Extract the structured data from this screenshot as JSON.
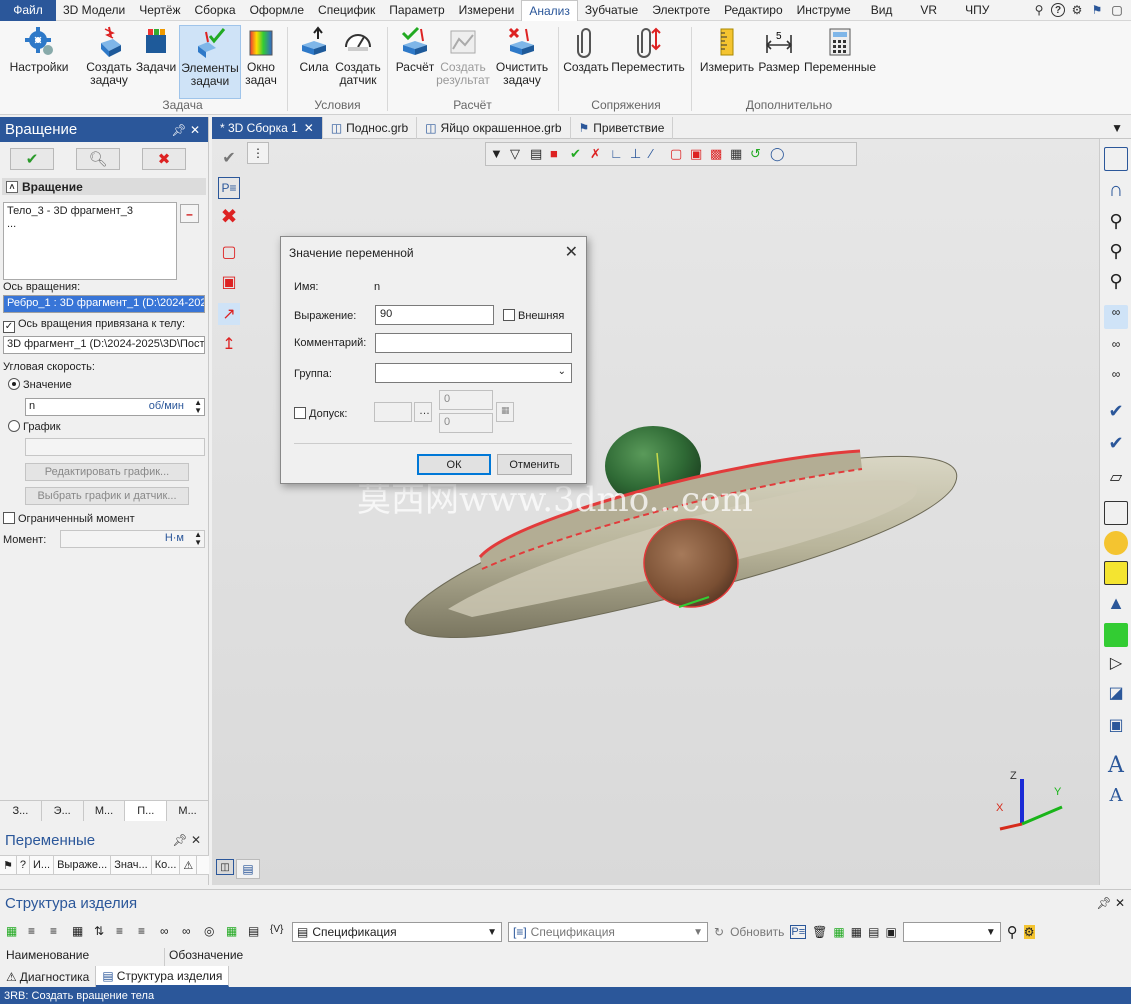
{
  "menu": {
    "file": "Файл",
    "items": [
      "3D Модели",
      "Чертёж",
      "Сборка",
      "Оформле",
      "Специфик",
      "Параметр",
      "Измерени",
      "Анализ",
      "Зубчатые",
      "Электроте",
      "Редактиро",
      "Инструме",
      "Вид",
      "VR",
      "ЧПУ"
    ],
    "active_index": 7
  },
  "ribbon": {
    "buttons": {
      "settings": "Настройки",
      "create_task": "Создать задачу",
      "tasks": "Задачи",
      "task_elements": "Элементы задачи",
      "task_window": "Окно задач",
      "force": "Сила",
      "create_sensor": "Создать датчик",
      "calculate": "Расчёт",
      "create_result": "Создать результат",
      "clear_task": "Очистить задачу",
      "create_mate": "Создать",
      "move": "Переместить",
      "measure": "Измерить",
      "dimension": "Размер",
      "variables": "Переменные"
    },
    "groups": {
      "task": "Задача",
      "conditions": "Условия",
      "calculation": "Расчёт",
      "mates": "Сопряжения",
      "additional": "Дополнительно"
    }
  },
  "left_panel": {
    "title": "Вращение",
    "section": "Вращение",
    "bodies": [
      "Тело_3 - 3D фрагмент_3",
      "..."
    ],
    "axis_label": "Ось вращения:",
    "axis_value": "Ребро_1 : 3D фрагмент_1 (D:\\2024-202",
    "axis_bound_label": "Ось вращения привязана к телу:",
    "axis_bound_checked": true,
    "axis_bound_value": "3D фрагмент_1 (D:\\2024-2025\\3D\\Пости",
    "ang_speed_label": "Угловая скорость:",
    "value_label": "Значение",
    "value_input": "n",
    "value_unit": "об/мин",
    "graph_label": "График",
    "edit_graph": "Редактировать график...",
    "select_graph": "Выбрать график и датчик...",
    "limited_moment": "Ограниченный момент",
    "moment_label": "Момент:",
    "moment_unit": "Н·м",
    "tabs": [
      "З...",
      "Э...",
      "М...",
      "П...",
      "М..."
    ],
    "vars_title": "Переменные",
    "vars_columns": [
      "?",
      "И...",
      "Выраже...",
      "Знач...",
      "Ко..."
    ]
  },
  "doc_tabs": [
    {
      "label": "* 3D Сборка 1",
      "active": true
    },
    {
      "label": "Поднос.grb",
      "active": false
    },
    {
      "label": "Яйцо окрашенное.grb",
      "active": false
    },
    {
      "label": "Приветствие",
      "active": false
    }
  ],
  "viewport": {
    "watermark": "莫西网www.3dmo...com",
    "axis_x": "X",
    "axis_y": "Y",
    "axis_z": "Z"
  },
  "dialog": {
    "title": "Значение переменной",
    "name_label": "Имя:",
    "name_value": "n",
    "expr_label": "Выражение:",
    "expr_value": "90",
    "external_label": "Внешняя",
    "comment_label": "Комментарий:",
    "group_label": "Группа:",
    "tolerance_label": "Допуск:",
    "tol_min": "0",
    "tol_max": "0",
    "ok": "ОК",
    "cancel": "Отменить"
  },
  "bottom": {
    "title": "Структура изделия",
    "spec_combo": "Спецификация",
    "spec_combo2": "Спецификация",
    "update": "Обновить",
    "col_name": "Наименование",
    "col_designation": "Обозначение",
    "tabs": [
      "Диагностика",
      "Структура изделия"
    ]
  },
  "status": "3RB: Создать вращение тела",
  "colors": {
    "accent": "#2b579a",
    "highlight": "#3875d7"
  }
}
